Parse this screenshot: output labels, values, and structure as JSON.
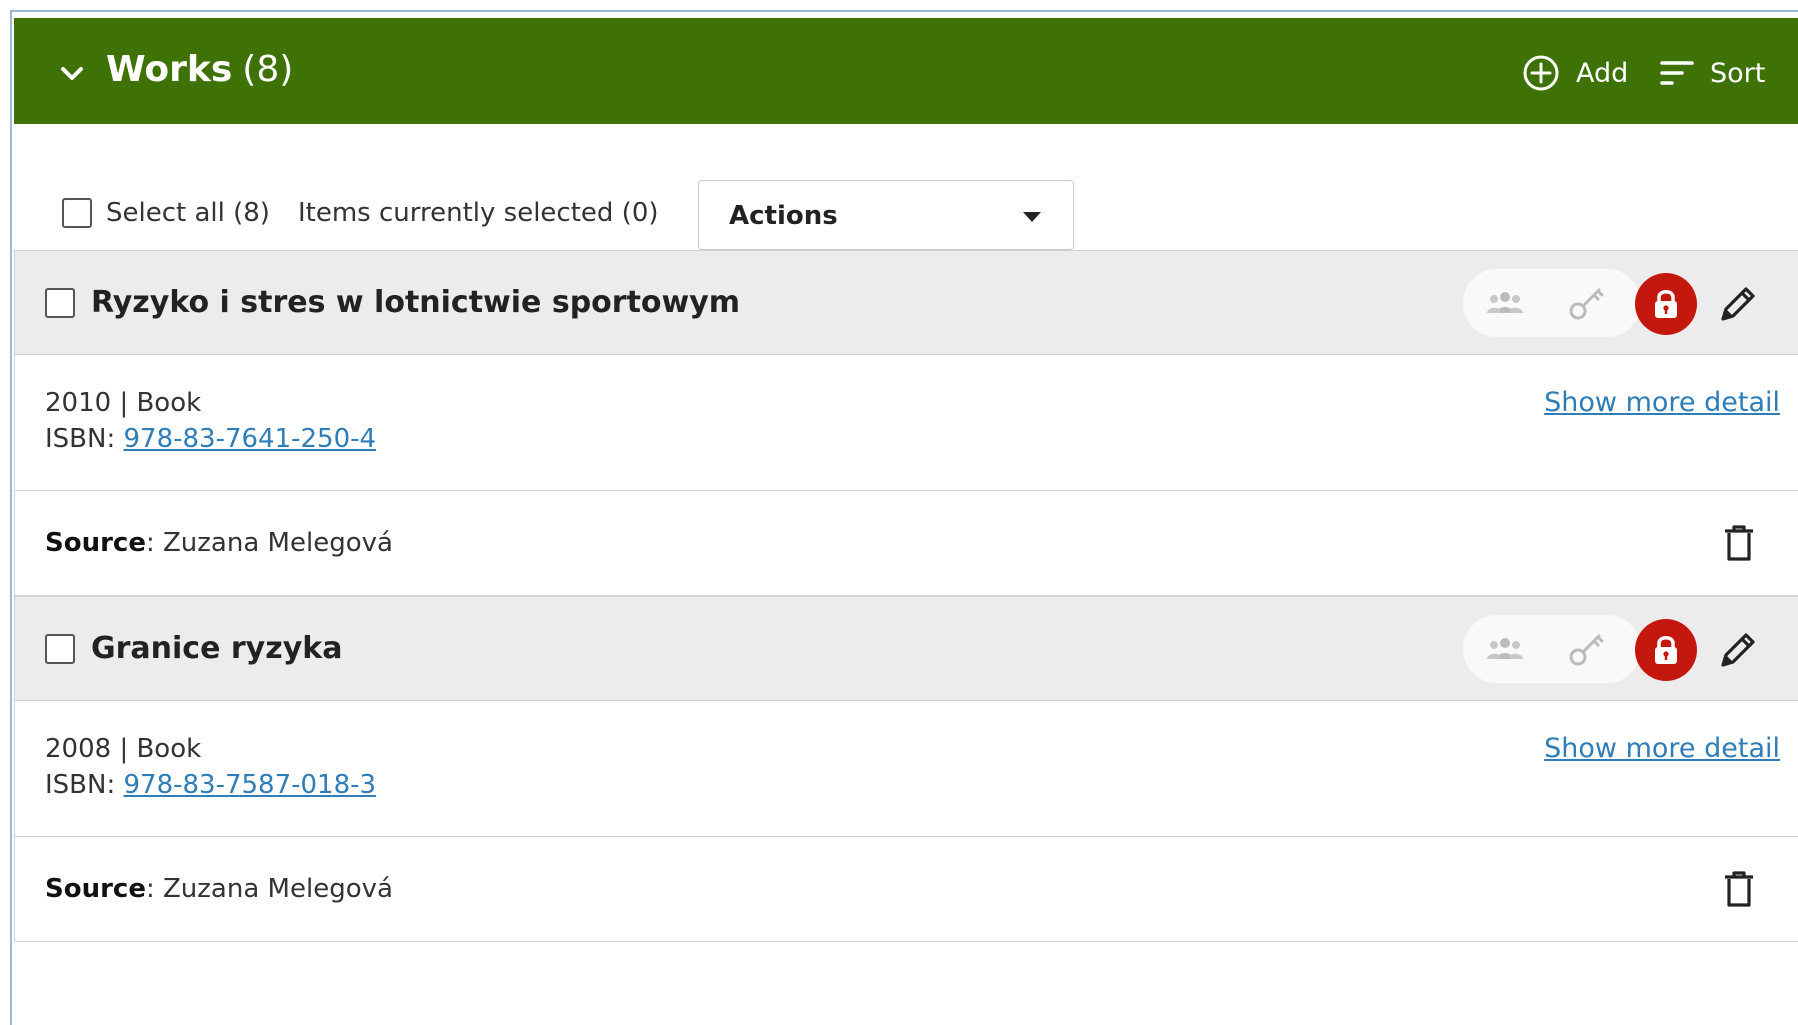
{
  "header": {
    "title": "Works",
    "count": "(8)",
    "add_label": "Add",
    "sort_label": "Sort",
    "bg_color": "#3f7206"
  },
  "toolbar": {
    "select_all_label": "Select all (8)",
    "items_selected_label": "Items currently selected (0)",
    "actions_label": "Actions"
  },
  "works": [
    {
      "title": "Ryzyko i stres w lotnictwie sportowym",
      "year": "2010",
      "separator": "|",
      "type": "Book",
      "isbn_label": "ISBN:",
      "isbn": "978-83-7641-250-4",
      "show_more": "Show more detail",
      "source_label": "Source",
      "source_value": ": Zuzana Melegová"
    },
    {
      "title": "Granice ryzyka",
      "year": "2008",
      "separator": "|",
      "type": "Book",
      "isbn_label": "ISBN:",
      "isbn": "978-83-7587-018-3",
      "show_more": "Show more detail",
      "source_label": "Source",
      "source_value": ": Zuzana Melegová"
    }
  ],
  "icons": {
    "visibility": "group-icon",
    "access": "key-icon",
    "private": "lock-icon",
    "edit": "pencil-icon",
    "delete": "trash-icon"
  },
  "colors": {
    "lock_red": "#c4170d",
    "link_blue": "#2f7db8"
  }
}
